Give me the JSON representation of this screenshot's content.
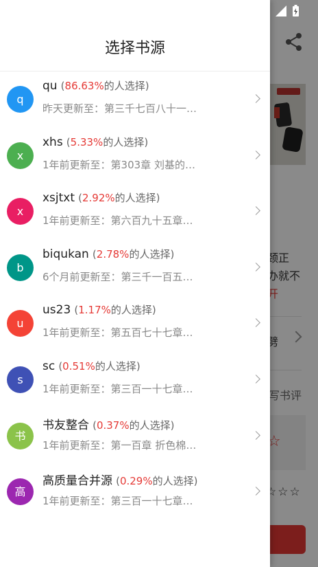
{
  "background": {
    "side_lines": [
      "颈正",
      "办就不"
    ],
    "side_red": "开",
    "side_item": "劈",
    "write_review": "写书评",
    "outline_star": "☆",
    "rating_stars": "☆☆☆"
  },
  "drawer": {
    "title": "选择书源",
    "suffix": "的人选择",
    "items": [
      {
        "avatar": "q",
        "color": "#2196f3",
        "name": "qu",
        "percent": "86.63%",
        "update": "昨天更新至：第三千七百八十一…"
      },
      {
        "avatar": "x",
        "color": "#4caf50",
        "name": "xhs",
        "percent": "5.33%",
        "update": "1年前更新至：第303章 刘基的…"
      },
      {
        "avatar": "x",
        "color": "#e91e63",
        "name": "xsjtxt",
        "percent": "2.92%",
        "update": "1年前更新至：第六百九十五章…"
      },
      {
        "avatar": "b",
        "color": "#009688",
        "name": "biqukan",
        "percent": "2.78%",
        "update": "6个月前更新至：第三千一百五…"
      },
      {
        "avatar": "u",
        "color": "#f44336",
        "name": "us23",
        "percent": "1.17%",
        "update": "1年前更新至：第五百七十七章…"
      },
      {
        "avatar": "s",
        "color": "#3f51b5",
        "name": "sc",
        "percent": "0.51%",
        "update": "1年前更新至：第三百一十七章…"
      },
      {
        "avatar": "书",
        "color": "#8bc34a",
        "name": "书友整合",
        "percent": "0.37%",
        "update": "1年前更新至：第一百章 折色棉…"
      },
      {
        "avatar": "高",
        "color": "#9c27b0",
        "name": "高质量合并源",
        "percent": "0.29%",
        "update": "1年前更新至：第三百一十七章…"
      }
    ]
  }
}
